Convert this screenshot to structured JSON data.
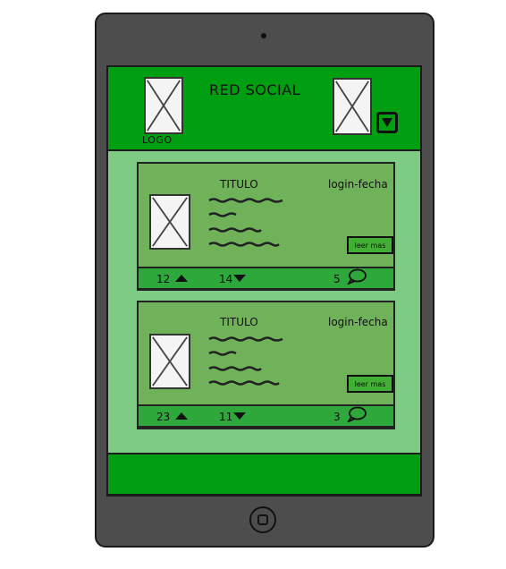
{
  "header": {
    "title": "RED SOCIAL",
    "logo_label": "LOGO"
  },
  "posts": [
    {
      "title": "TITULO",
      "meta": "login-fecha",
      "read_more": "leer mas",
      "upvotes": "12",
      "downvotes": "14",
      "comments": "5"
    },
    {
      "title": "TITULO",
      "meta": "login-fecha",
      "read_more": "leer mas",
      "upvotes": "23",
      "downvotes": "11",
      "comments": "3"
    }
  ],
  "colors": {
    "device": "#4d4d4d",
    "header_green": "#009e11",
    "screen_green": "#7ecb84",
    "card_green": "#6fb25a",
    "bar_green": "#2ea83a"
  },
  "icons": [
    "image-placeholder-icon",
    "dropdown-arrow-icon",
    "upvote-icon",
    "downvote-icon",
    "comment-icon",
    "home-button-icon"
  ]
}
